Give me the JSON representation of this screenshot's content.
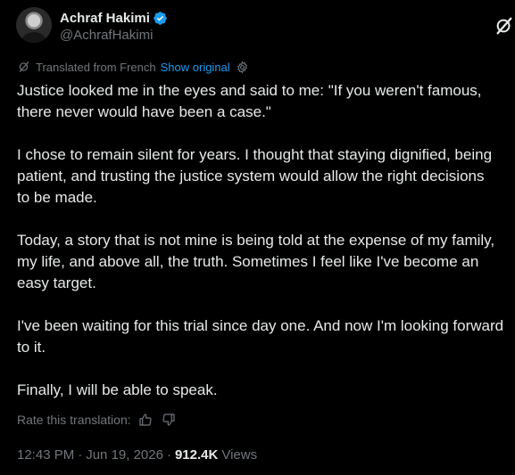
{
  "author": {
    "name": "Achraf Hakimi",
    "handle": "@AchrafHakimi",
    "verified_color": "#1d9bf0",
    "avatar_icon": "profile-photo"
  },
  "translation": {
    "label": "Translated from French",
    "show_original": "Show original",
    "rate_label": "Rate this translation:"
  },
  "body": {
    "paragraphs": [
      [
        "Justice looked me in the eyes and said to me: \"If you weren't famous,",
        "there never would have been a case.\""
      ],
      [
        "I chose to remain silent for years. I thought that staying dignified, being",
        "patient, and trusting the justice system would allow the right decisions",
        "to be made."
      ],
      [
        "Today, a story that is not mine is being told at the expense of my family,",
        "my life, and above all, the truth. Sometimes I feel like I've become an",
        "easy target."
      ],
      [
        "I've been waiting for this trial since day one. And now I'm looking forward",
        "to it."
      ],
      [
        "Finally, I will be able to speak."
      ]
    ]
  },
  "meta": {
    "time": "12:43 PM",
    "separator": "·",
    "date": "Jun 19, 2026",
    "views_count": "912.4K",
    "views_label": "Views"
  },
  "colors": {
    "background": "#000000",
    "text": "#e7e9ea",
    "secondary": "#71767b",
    "link": "#1d9bf0"
  }
}
